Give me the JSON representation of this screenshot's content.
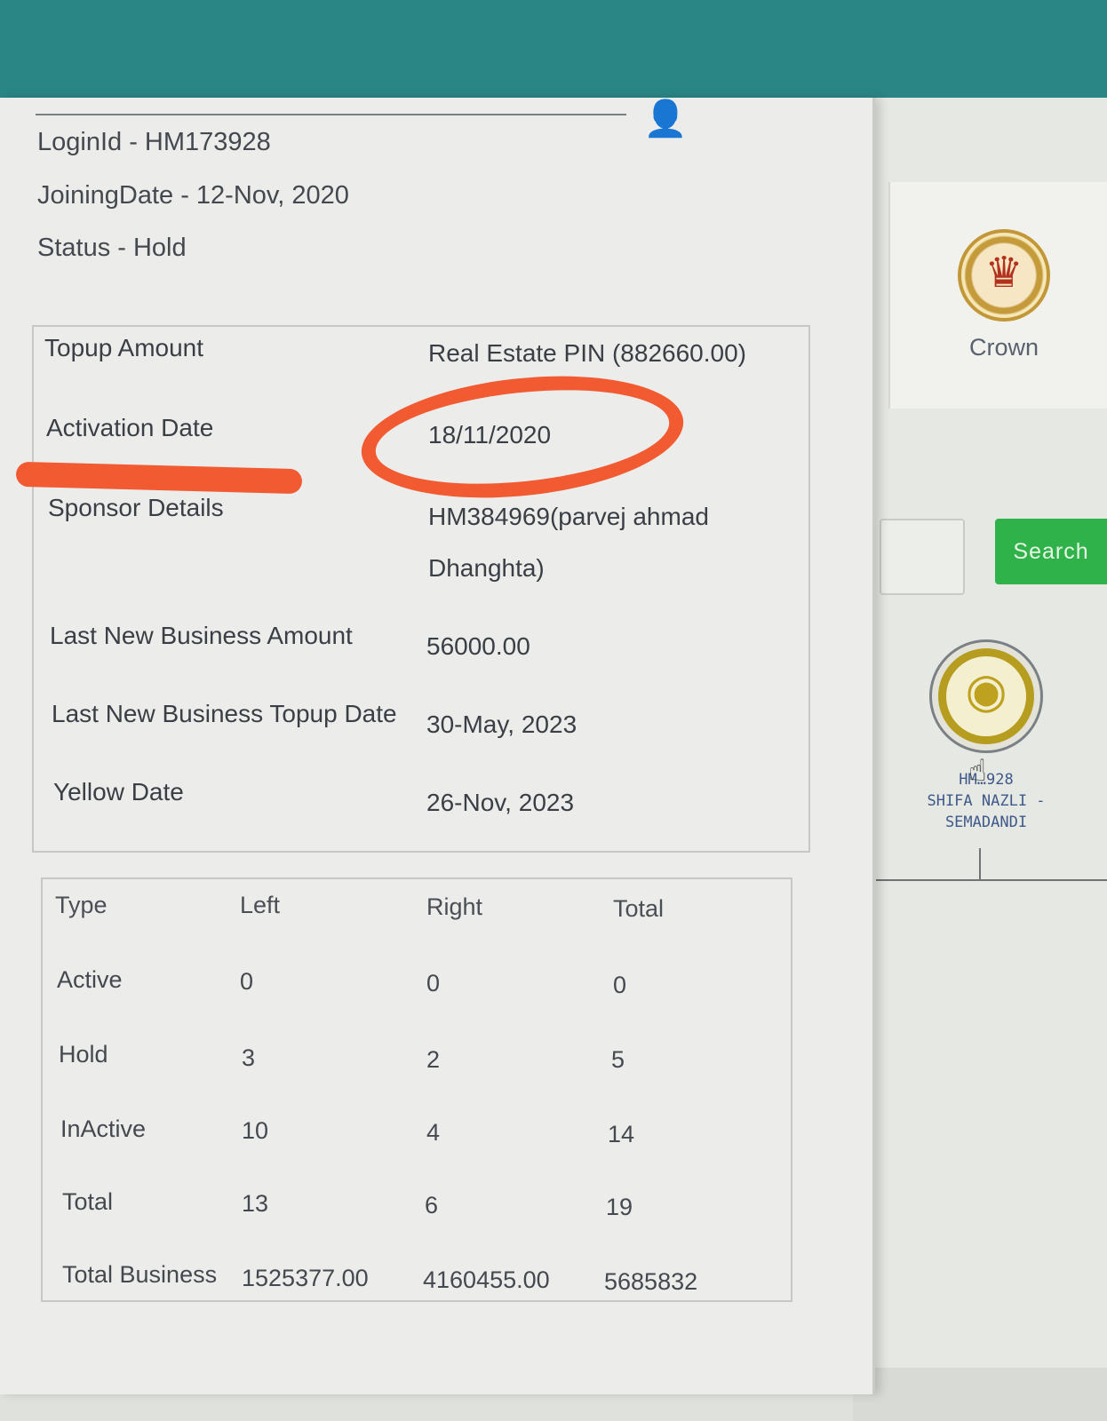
{
  "account": {
    "login_id": "LoginId - HM173928",
    "joining_date": "JoiningDate - 12-Nov, 2020",
    "status": "Status - Hold"
  },
  "details": [
    {
      "label": "Topup Amount",
      "value": "Real Estate PIN (882660.00)"
    },
    {
      "label": "Activation Date",
      "value": "18/11/2020"
    },
    {
      "label": "Sponsor Details",
      "value_line1": "HM384969(parvej ahmad",
      "value_line2": "Dhanghta)"
    },
    {
      "label": "Last New Business Amount",
      "value": "56000.00"
    },
    {
      "label": "Last New Business Topup Date",
      "value": "30-May, 2023"
    },
    {
      "label": "Yellow Date",
      "value": "26-Nov, 2023"
    }
  ],
  "counts_table": {
    "headers": [
      "Type",
      "Left",
      "Right",
      "Total"
    ],
    "rows": [
      [
        "Active",
        "0",
        "0",
        "0"
      ],
      [
        "Hold",
        "3",
        "2",
        "5"
      ],
      [
        "InActive",
        "10",
        "4",
        "14"
      ],
      [
        "Total",
        "13",
        "6",
        "19"
      ],
      [
        "Total Business",
        "1525377.00",
        "4160455.00",
        "5685832"
      ]
    ]
  },
  "sidebar": {
    "rank_label": "Crown",
    "search_label": "Search",
    "member_line1": "HM…928",
    "member_line2": "SHIFA NAZLI -",
    "member_line3": "SEMADANDI"
  },
  "icons": {
    "rank_icon": "crown-icon",
    "user_icon": "user-icon",
    "member_icon": "member-avatar-icon",
    "cursor": "hand-pointer-icon"
  },
  "colors": {
    "topbar": "#2a8585",
    "search_button": "#2fb24a",
    "annotation": "#f25a32",
    "member_ring": "#b79d1f"
  }
}
